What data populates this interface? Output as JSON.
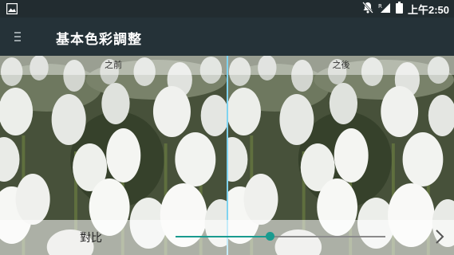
{
  "status_bar": {
    "time": "上午2:50",
    "icons": [
      "gallery-notification-icon",
      "bell-off-icon",
      "roaming-signal-icon",
      "battery-icon"
    ]
  },
  "app_bar": {
    "title": "基本色彩調整",
    "menu_icon": "hamburger-menu-icon"
  },
  "compare": {
    "before_label": "之前",
    "after_label": "之後"
  },
  "adjustment": {
    "label": "對比",
    "value_fraction": 0.45,
    "accent_color": "#1a9b8f",
    "next_icon": "chevron-right-icon"
  }
}
